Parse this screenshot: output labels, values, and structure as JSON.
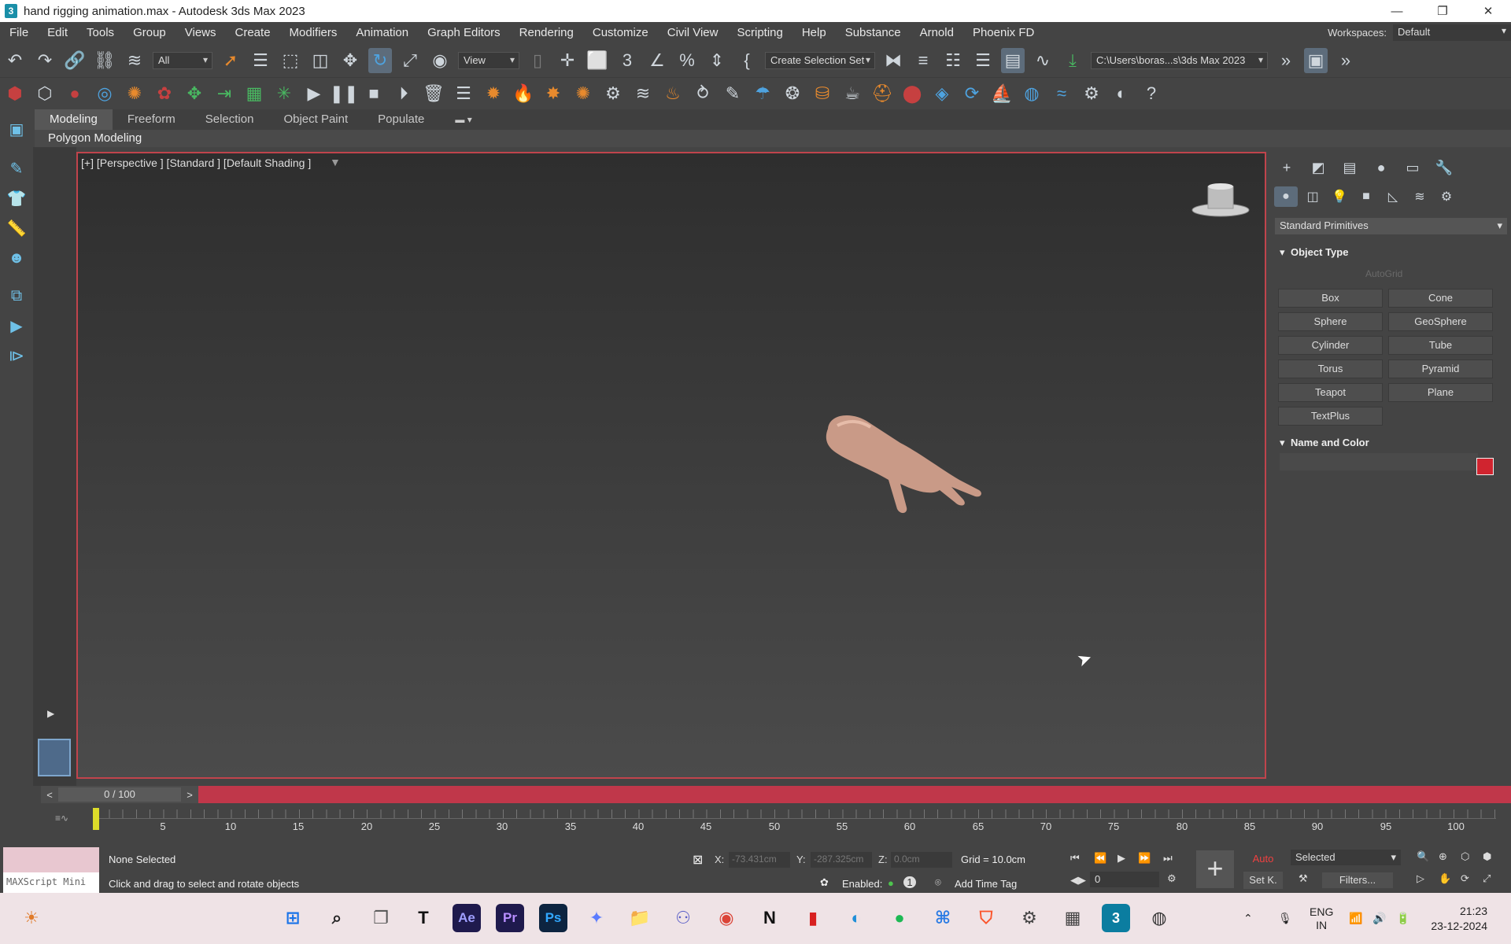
{
  "window": {
    "title": "hand rigging animation.max - Autodesk 3ds Max 2023",
    "app_icon_letter": "3",
    "controls": [
      "—",
      "❐",
      "✕"
    ]
  },
  "menubar": {
    "items": [
      "File",
      "Edit",
      "Tools",
      "Group",
      "Views",
      "Create",
      "Modifiers",
      "Animation",
      "Graph Editors",
      "Rendering",
      "Customize",
      "Civil View",
      "Scripting",
      "Help",
      "Substance",
      "Arnold",
      "Phoenix FD"
    ],
    "workspaces_label": "Workspaces:",
    "workspaces_value": "Default"
  },
  "toolbar": {
    "selection_filter": "All",
    "reference_coord": "View",
    "selection_set": "Create Selection Set",
    "project_path": "C:\\Users\\boras...s\\3ds Max 2023"
  },
  "ribbon": {
    "tabs": [
      "Modeling",
      "Freeform",
      "Selection",
      "Object Paint",
      "Populate"
    ],
    "active_tab": "Modeling",
    "panel_label": "Polygon Modeling"
  },
  "viewport": {
    "label": "[+] [Perspective ] [Standard ] [Default Shading ]"
  },
  "command_panel": {
    "category": "Standard Primitives",
    "object_type_title": "Object Type",
    "autogrid": "AutoGrid",
    "primitives": [
      "Box",
      "Cone",
      "Sphere",
      "GeoSphere",
      "Cylinder",
      "Tube",
      "Torus",
      "Pyramid",
      "Teapot",
      "Plane",
      "TextPlus"
    ],
    "name_color_title": "Name and Color",
    "object_color": "#d0242f"
  },
  "timeline": {
    "frame_display": "0 / 100",
    "prev": "<",
    "next": ">",
    "tick_labels": [
      "5",
      "10",
      "15",
      "20",
      "25",
      "30",
      "35",
      "40",
      "45",
      "50",
      "55",
      "60",
      "65",
      "70",
      "75",
      "80",
      "85",
      "90",
      "95",
      "100"
    ]
  },
  "status": {
    "maxscript": "MAXScript Mini",
    "selection": "None Selected",
    "prompt": "Click and drag to select and rotate objects",
    "x_label": "X:",
    "x_value": "-73.431cm",
    "y_label": "Y:",
    "y_value": "-287.325cm",
    "z_label": "Z:",
    "z_value": "0.0cm",
    "grid": "Grid = 10.0cm",
    "enabled_label": "Enabled:",
    "enabled_count": "1",
    "add_time_tag": "Add Time Tag",
    "current_frame": "0",
    "auto_key": "Auto",
    "set_key": "Set K.",
    "key_filter_set": "Selected",
    "filters": "Filters..."
  },
  "taskbar": {
    "apps": [
      "Ae",
      "Pr",
      "Ps"
    ],
    "language_line1": "ENG",
    "language_line2": "IN",
    "time": "21:23",
    "date": "23-12-2024"
  }
}
